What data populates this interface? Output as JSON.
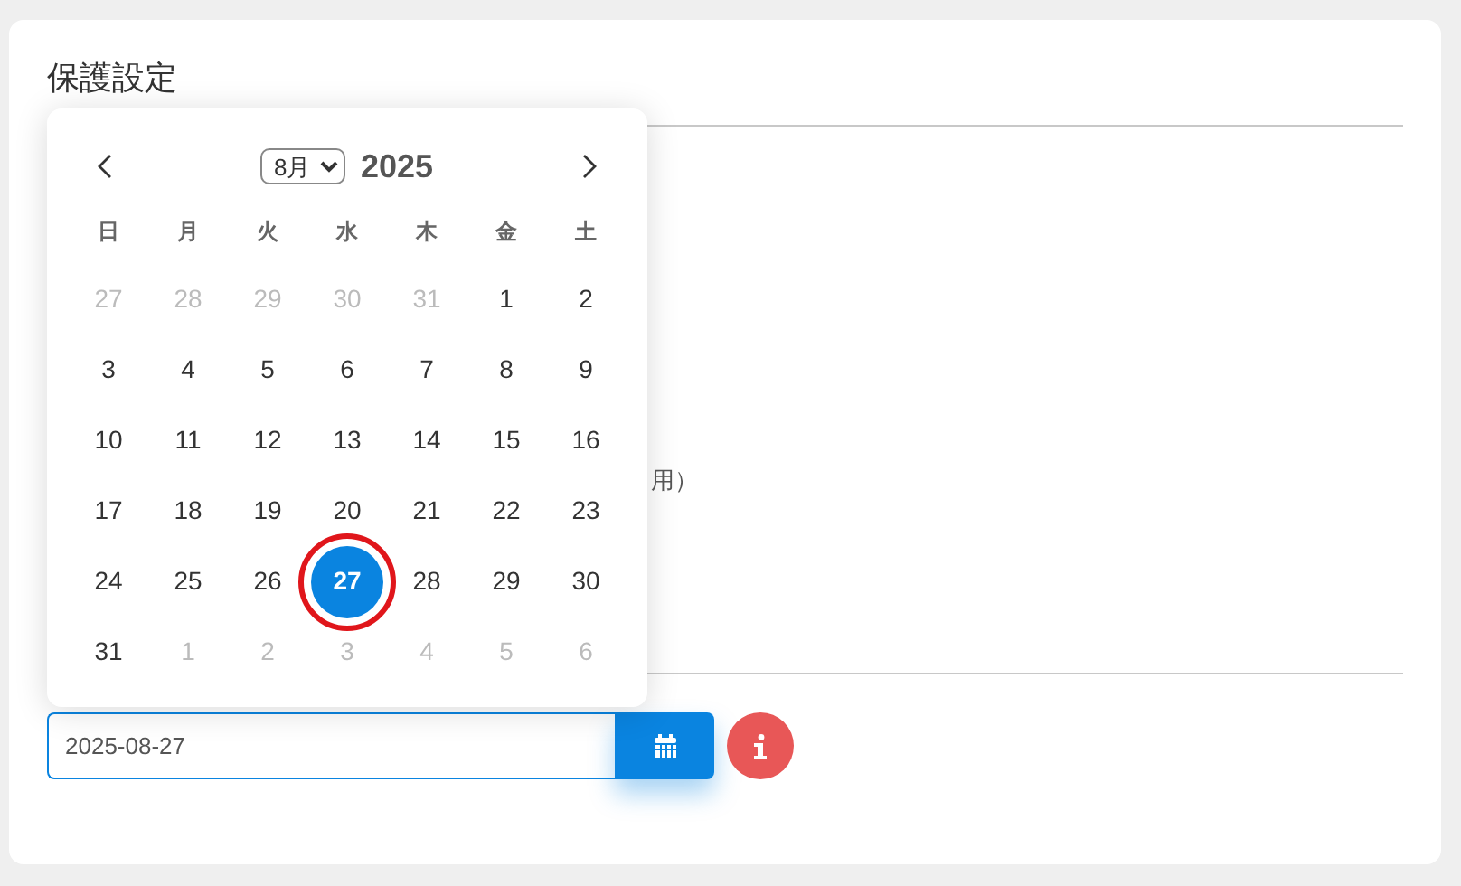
{
  "card": {
    "title": "保護設定",
    "hidden_text": "用）"
  },
  "date_field": {
    "value": "2025-08-27"
  },
  "calendar": {
    "month": "8月",
    "year": "2025",
    "weekdays": [
      "日",
      "月",
      "火",
      "水",
      "木",
      "金",
      "土"
    ],
    "days": [
      {
        "label": "27",
        "outside": true,
        "selected": false,
        "circled": false
      },
      {
        "label": "28",
        "outside": true,
        "selected": false,
        "circled": false
      },
      {
        "label": "29",
        "outside": true,
        "selected": false,
        "circled": false
      },
      {
        "label": "30",
        "outside": true,
        "selected": false,
        "circled": false
      },
      {
        "label": "31",
        "outside": true,
        "selected": false,
        "circled": false
      },
      {
        "label": "1",
        "outside": false,
        "selected": false,
        "circled": false
      },
      {
        "label": "2",
        "outside": false,
        "selected": false,
        "circled": false
      },
      {
        "label": "3",
        "outside": false,
        "selected": false,
        "circled": false
      },
      {
        "label": "4",
        "outside": false,
        "selected": false,
        "circled": false
      },
      {
        "label": "5",
        "outside": false,
        "selected": false,
        "circled": false
      },
      {
        "label": "6",
        "outside": false,
        "selected": false,
        "circled": false
      },
      {
        "label": "7",
        "outside": false,
        "selected": false,
        "circled": false
      },
      {
        "label": "8",
        "outside": false,
        "selected": false,
        "circled": false
      },
      {
        "label": "9",
        "outside": false,
        "selected": false,
        "circled": false
      },
      {
        "label": "10",
        "outside": false,
        "selected": false,
        "circled": false
      },
      {
        "label": "11",
        "outside": false,
        "selected": false,
        "circled": false
      },
      {
        "label": "12",
        "outside": false,
        "selected": false,
        "circled": false
      },
      {
        "label": "13",
        "outside": false,
        "selected": false,
        "circled": false
      },
      {
        "label": "14",
        "outside": false,
        "selected": false,
        "circled": false
      },
      {
        "label": "15",
        "outside": false,
        "selected": false,
        "circled": false
      },
      {
        "label": "16",
        "outside": false,
        "selected": false,
        "circled": false
      },
      {
        "label": "17",
        "outside": false,
        "selected": false,
        "circled": false
      },
      {
        "label": "18",
        "outside": false,
        "selected": false,
        "circled": false
      },
      {
        "label": "19",
        "outside": false,
        "selected": false,
        "circled": false
      },
      {
        "label": "20",
        "outside": false,
        "selected": false,
        "circled": false
      },
      {
        "label": "21",
        "outside": false,
        "selected": false,
        "circled": false
      },
      {
        "label": "22",
        "outside": false,
        "selected": false,
        "circled": false
      },
      {
        "label": "23",
        "outside": false,
        "selected": false,
        "circled": false
      },
      {
        "label": "24",
        "outside": false,
        "selected": false,
        "circled": false
      },
      {
        "label": "25",
        "outside": false,
        "selected": false,
        "circled": false
      },
      {
        "label": "26",
        "outside": false,
        "selected": false,
        "circled": false
      },
      {
        "label": "27",
        "outside": false,
        "selected": true,
        "circled": true
      },
      {
        "label": "28",
        "outside": false,
        "selected": false,
        "circled": false
      },
      {
        "label": "29",
        "outside": false,
        "selected": false,
        "circled": false
      },
      {
        "label": "30",
        "outside": false,
        "selected": false,
        "circled": false
      },
      {
        "label": "31",
        "outside": false,
        "selected": false,
        "circled": false
      },
      {
        "label": "1",
        "outside": true,
        "selected": false,
        "circled": false
      },
      {
        "label": "2",
        "outside": true,
        "selected": false,
        "circled": false
      },
      {
        "label": "3",
        "outside": true,
        "selected": false,
        "circled": false
      },
      {
        "label": "4",
        "outside": true,
        "selected": false,
        "circled": false
      },
      {
        "label": "5",
        "outside": true,
        "selected": false,
        "circled": false
      },
      {
        "label": "6",
        "outside": true,
        "selected": false,
        "circled": false
      }
    ]
  }
}
